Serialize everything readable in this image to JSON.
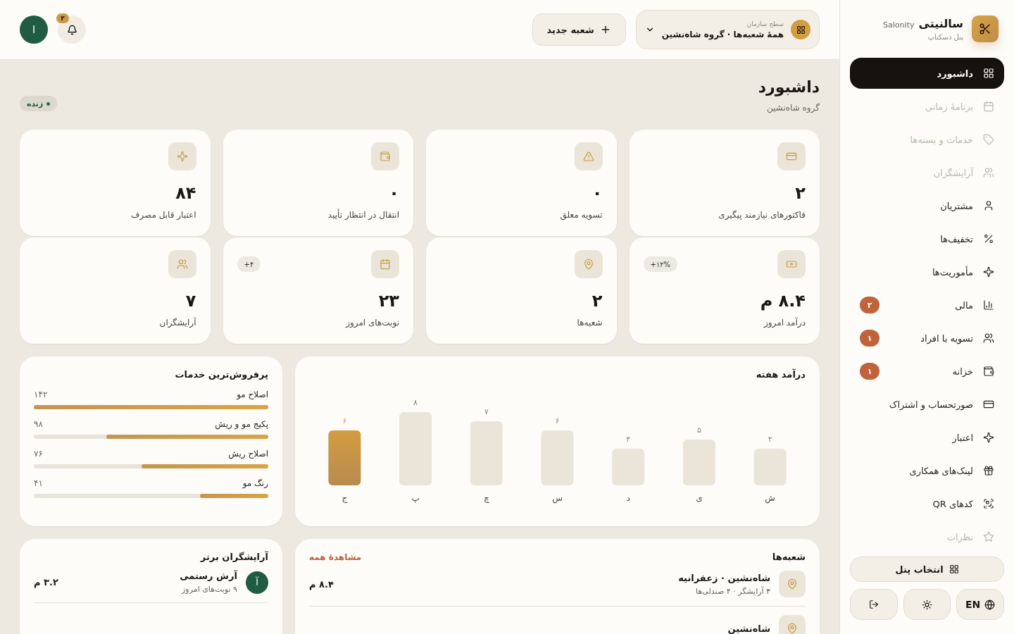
{
  "sidebar": {
    "brand": {
      "name": "سالنیتی",
      "latin": "Salonity",
      "subtitle": "پنل دسکتاپ"
    },
    "items": [
      {
        "label": "داشبورد",
        "selected": true,
        "disabled": false
      },
      {
        "label": "برنامهٔ زمانی",
        "selected": false,
        "disabled": true
      },
      {
        "label": "خدمات و بسته‌ها",
        "selected": false,
        "disabled": true
      },
      {
        "label": "آرایشگران",
        "selected": false,
        "disabled": true
      },
      {
        "label": "مشتریان",
        "selected": false,
        "disabled": false
      },
      {
        "label": "تخفیف‌ها",
        "selected": false,
        "disabled": false
      },
      {
        "label": "مأموریت‌ها",
        "selected": false,
        "disabled": false
      },
      {
        "label": "مالی",
        "selected": false,
        "disabled": false,
        "badge": "۲"
      },
      {
        "label": "تسویه با افراد",
        "selected": false,
        "disabled": false,
        "badge": "۱"
      },
      {
        "label": "خزانه",
        "selected": false,
        "disabled": false,
        "badge": "۱"
      },
      {
        "label": "صورتحساب و اشتراک",
        "selected": false,
        "disabled": false
      },
      {
        "label": "اعتبار",
        "selected": false,
        "disabled": false
      },
      {
        "label": "لینک‌های همکاری",
        "selected": false,
        "disabled": false
      },
      {
        "label": "کدهای QR",
        "selected": false,
        "disabled": false
      },
      {
        "label": "نظرات",
        "selected": false,
        "disabled": true
      }
    ],
    "panel_button": "انتخاب پنل",
    "language_button": "EN"
  },
  "header": {
    "org_label": "سطح سازمان",
    "org_value": "همهٔ شعبه‌ها · گروه شاه‌نشین",
    "new_branch": "شعبه جدید",
    "notifications": "۳",
    "avatar": "ا"
  },
  "page": {
    "title": "داشبورد",
    "subtitle": "گروه شاه‌نشین",
    "live": "زنده"
  },
  "stats": [
    {
      "value": "۲",
      "label": "فاکتورهای نیازمند پیگیری"
    },
    {
      "value": "۰",
      "label": "تسویه معلق"
    },
    {
      "value": "۰",
      "label": "انتقال در انتظار تأیید"
    },
    {
      "value": "۸۴",
      "label": "اعتبار قابل مصرف"
    },
    {
      "value": "۸.۴ م",
      "label": "درآمد امروز",
      "delta": "+۱۲%"
    },
    {
      "value": "۲",
      "label": "شعبه‌ها"
    },
    {
      "value": "۲۳",
      "label": "نوبت‌های امروز",
      "delta": "+۴"
    },
    {
      "value": "۷",
      "label": "آرایشگران"
    }
  ],
  "weekly_revenue": {
    "bar_states": [
      {
        "selected": true
      },
      {
        "selected": false
      },
      {
        "selected": false
      },
      {
        "selected": false
      },
      {
        "selected": false
      },
      {
        "selected": false
      },
      {
        "selected": false
      }
    ],
    "chart_data": {
      "type": "bar",
      "title": "درآمد هفته",
      "categories": [
        "ج",
        "پ",
        "چ",
        "س",
        "د",
        "ی",
        "ش"
      ],
      "values": [
        6,
        8,
        7,
        6,
        4,
        5,
        4
      ],
      "ylim": [
        0,
        8
      ],
      "data_labels": true,
      "value_labels": [
        "۶",
        "۸",
        "۷",
        "۶",
        "۴",
        "۵",
        "۴"
      ]
    }
  },
  "top_services": {
    "title": "پرفروش‌ترین خدمات",
    "items": [
      {
        "name": "اصلاح مو",
        "count": "۱۴۲",
        "level": 1
      },
      {
        "name": "پکیج مو و ریش",
        "count": "۹۸",
        "level": 0.69
      },
      {
        "name": "اصلاح ریش",
        "count": "۷۶",
        "level": 0.54
      },
      {
        "name": "رنگ مو",
        "count": "۴۱",
        "level": 0.29
      }
    ]
  },
  "branches": {
    "title": "شعبه‌ها",
    "view_all": "مشاهدهٔ همه",
    "rows": [
      {
        "name": "شاه‌نشین · زعفرانیه",
        "detail": "۳ آرایشگر · ۴ صندلی‌ها",
        "revenue": "۸.۴ م"
      },
      {
        "name": "شاه‌نشین"
      }
    ]
  },
  "top_barbers": {
    "title": "آرایشگران برتر",
    "rows": [
      {
        "initial": "آ",
        "name": "آرش رستمی",
        "detail": "۹ نوبت‌های امروز",
        "revenue": "۳.۲ م"
      }
    ]
  }
}
